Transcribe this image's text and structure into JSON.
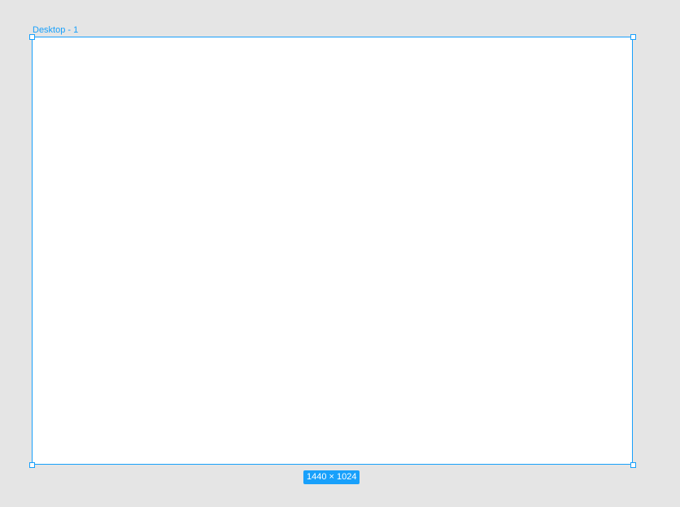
{
  "canvas": {
    "background": "#e5e5e5"
  },
  "frame": {
    "name": "Desktop - 1",
    "size_label": "1440 × 1024",
    "fill": "#ffffff",
    "selection_color": "#18a0fb"
  }
}
